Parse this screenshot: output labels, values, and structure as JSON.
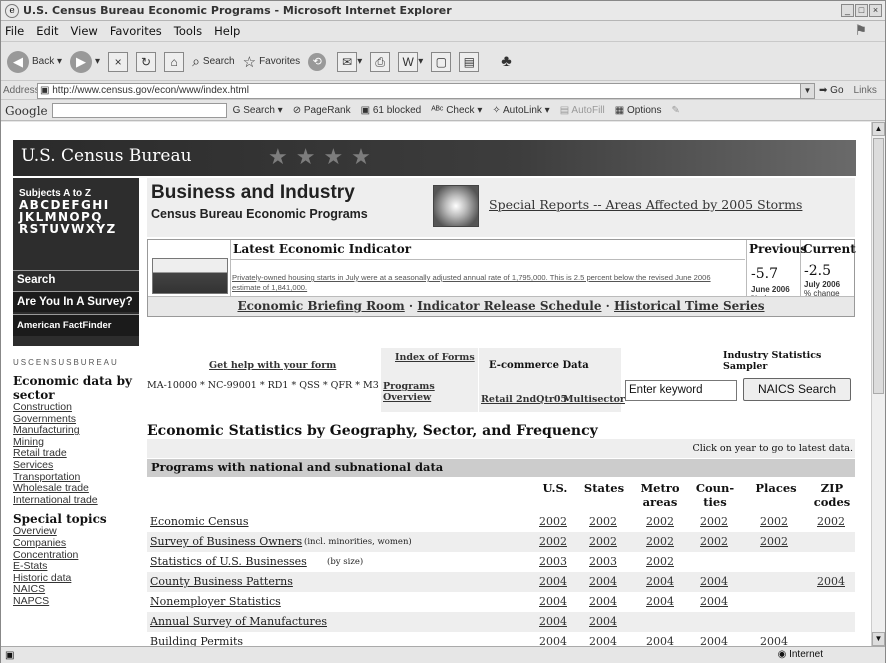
{
  "window": {
    "title": "U.S. Census Bureau Economic Programs - Microsoft Internet Explorer"
  },
  "menu": [
    "File",
    "Edit",
    "View",
    "Favorites",
    "Tools",
    "Help"
  ],
  "toolbar": {
    "back": "Back",
    "search": "Search",
    "favorites": "Favorites"
  },
  "address": {
    "label": "Address",
    "url": "http://www.census.gov/econ/www/index.html",
    "go": "Go",
    "links": "Links"
  },
  "google_bar": {
    "logo": "Google",
    "search": "Search",
    "pagerank": "PageRank",
    "blocked": "61 blocked",
    "check": "Check",
    "autolink": "AutoLink",
    "autofill": "AutoFill",
    "options": "Options"
  },
  "status": {
    "zone": "Internet"
  },
  "header": {
    "site_name": "U.S. Census Bureau"
  },
  "left_nav": {
    "subjects_title": "Subjects A to Z",
    "alphabet": [
      "ABCDEFGHI",
      "JKLMNOPQ",
      "RSTUVWXYZ"
    ],
    "search": "Search",
    "survey": "Are You In A Survey?",
    "factfinder": "American FactFinder",
    "wordmark": "USCENSUSBUREAU",
    "sector_heading": "Economic data by sector",
    "sector_links": [
      "Construction",
      "Governments",
      "Manufacturing",
      "Mining",
      "Retail trade",
      "Services",
      "Transportation",
      "Wholesale trade",
      "International trade"
    ],
    "topics_heading": "Special topics",
    "topic_links": [
      "Overview",
      "Companies",
      "Concentration",
      "E-Stats",
      "Historic data",
      "NAICS",
      "NAPCS"
    ]
  },
  "banner": {
    "title": "Business and Industry",
    "subtitle": "Census Bureau Economic Programs",
    "special_reports": "Special Reports -- Areas Affected by 2005 Storms"
  },
  "indicator": {
    "heading": "Latest Economic Indicator",
    "text": "Privately-owned housing starts in July were at a seasonally adjusted annual rate of 1,795,000. This is 2.5 percent below the revised June 2006 estimate of 1,841,000.",
    "previous_label": "Previous",
    "current_label": "Current",
    "previous_value": "-5.7",
    "previous_period": "June 2006",
    "current_value": "-2.5",
    "current_period": "July 2006",
    "change_label": "% change",
    "links": [
      "Economic Briefing Room",
      "Indicator Release Schedule",
      "Historical Time Series"
    ]
  },
  "forms": {
    "help": "Get help with your form",
    "form_list": "MA-10000 * NC-99001 * RD1 * QSS * QFR * M3",
    "index_of_forms": "Index of Forms",
    "programs_overview": "Programs Overview",
    "ecommerce_heading": "E-commerce Data",
    "retail": "Retail 2ndQtr05",
    "multisector": "Multisector",
    "sampler": "Industry Statistics Sampler",
    "keyword_placeholder": "Enter keyword",
    "naics_button": "NAICS Search"
  },
  "stats": {
    "heading": "Economic Statistics by Geography, Sector, and Frequency",
    "click_note": "Click on year to go to latest data.",
    "programs_heading": "Programs with national and subnational data",
    "columns": [
      "U.S.",
      "States",
      "Metro areas",
      "Coun- ties",
      "Places",
      "ZIP codes"
    ],
    "rows": [
      {
        "name": "Economic Census",
        "note": "",
        "years": [
          "2002",
          "2002",
          "2002",
          "2002",
          "2002",
          "2002"
        ]
      },
      {
        "name": "Survey of Business Owners",
        "note": "(incl. minorities, women)",
        "years": [
          "2002",
          "2002",
          "2002",
          "2002",
          "2002",
          ""
        ]
      },
      {
        "name": "Statistics of U.S. Businesses",
        "note": "(by size)",
        "years": [
          "2003",
          "2003",
          "2002",
          "",
          "",
          ""
        ]
      },
      {
        "name": "County Business Patterns",
        "note": "",
        "years": [
          "2004",
          "2004",
          "2004",
          "2004",
          "",
          "2004"
        ]
      },
      {
        "name": "Nonemployer Statistics",
        "note": "",
        "years": [
          "2004",
          "2004",
          "2004",
          "2004",
          "",
          ""
        ]
      },
      {
        "name": "Annual Survey of Manufactures",
        "note": "",
        "years": [
          "2004",
          "2004",
          "",
          "",
          "",
          ""
        ]
      },
      {
        "name": "Building Permits",
        "note": "",
        "years": [
          "2004",
          "2004",
          "2004",
          "2004",
          "2004",
          ""
        ]
      }
    ]
  }
}
